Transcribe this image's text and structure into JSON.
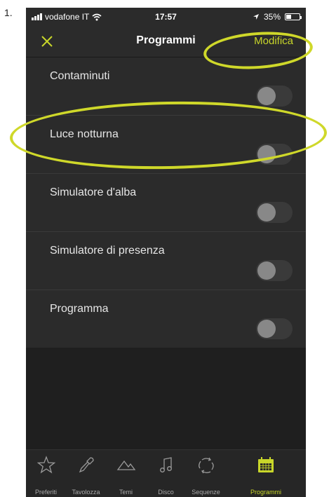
{
  "step": {
    "number": "1."
  },
  "status_bar": {
    "carrier": "vodafone IT",
    "time": "17:57",
    "battery_percent": "35%"
  },
  "nav": {
    "title": "Programmi",
    "edit_label": "Modifica"
  },
  "programs": [
    {
      "label": "Contaminuti",
      "enabled": false
    },
    {
      "label": "Luce notturna",
      "enabled": false
    },
    {
      "label": "Simulatore d'alba",
      "enabled": false
    },
    {
      "label": "Simulatore di presenza",
      "enabled": false
    },
    {
      "label": "Programma",
      "enabled": false
    }
  ],
  "tabs": [
    {
      "label": "Preferiti",
      "icon": "star-icon"
    },
    {
      "label": "Tavolozza",
      "icon": "eyedropper-icon"
    },
    {
      "label": "Temi",
      "icon": "mountains-icon"
    },
    {
      "label": "Disco",
      "icon": "music-note-icon"
    },
    {
      "label": "Sequenze",
      "icon": "cycle-arrows-icon"
    },
    {
      "label": "Programmi",
      "icon": "calendar-icon",
      "active": true
    }
  ],
  "colors": {
    "accent": "#c8d62a",
    "background": "#2b2b2b",
    "highlight": "#cfd82a"
  }
}
